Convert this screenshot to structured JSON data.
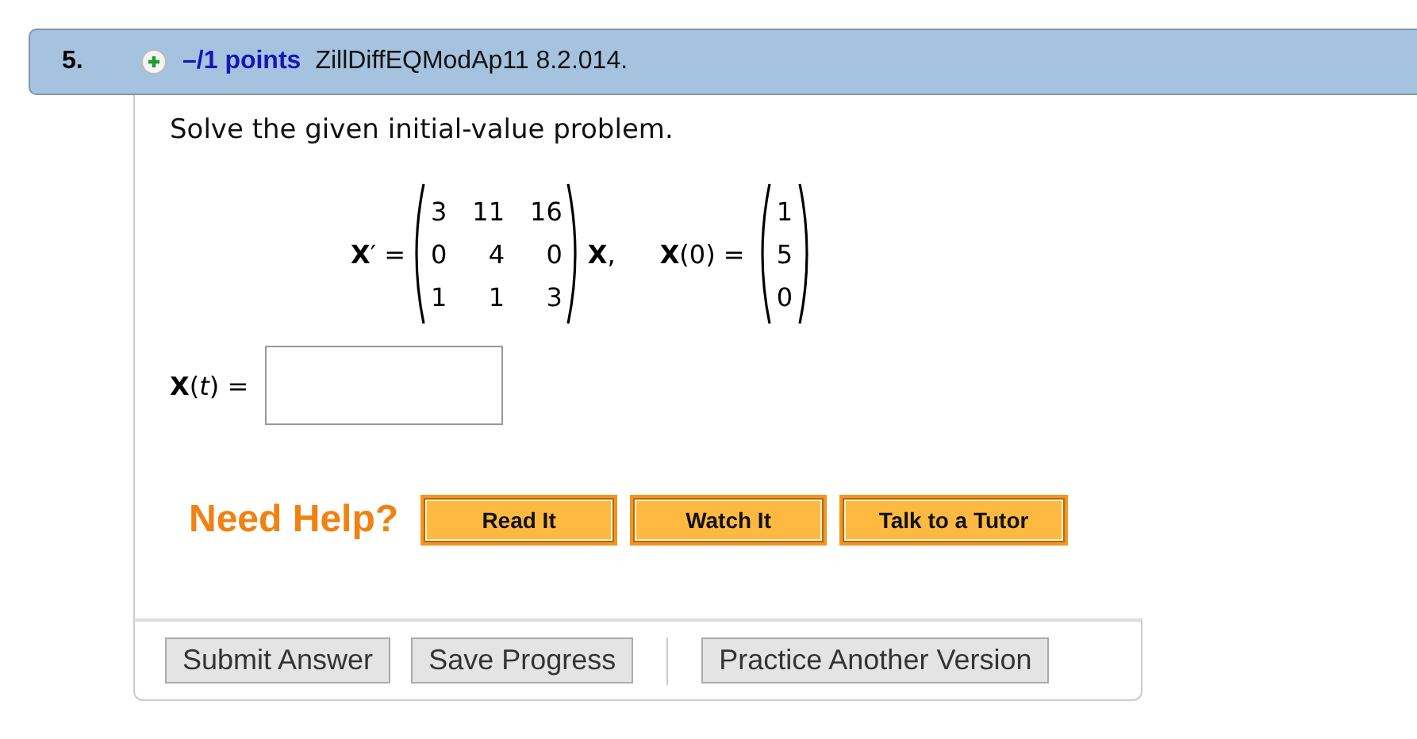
{
  "header": {
    "number": "5.",
    "points": "–/1 points",
    "source": "ZillDiffEQModAp11 8.2.014."
  },
  "prompt": "Solve the given initial-value problem.",
  "equation": {
    "lhs": "**X**′ =",
    "matrix": [
      [
        "3",
        "11",
        "16"
      ],
      [
        "0",
        "4",
        "0"
      ],
      [
        "1",
        "1",
        "3"
      ]
    ],
    "after_matrix": "**X**,",
    "initial_lhs": "**X**(0) =",
    "vector": [
      "1",
      "5",
      "0"
    ]
  },
  "answer": {
    "label": "**X**(*t*) ="
  },
  "help": {
    "label": "Need Help?",
    "buttons": [
      "Read It",
      "Watch It",
      "Talk to a Tutor"
    ]
  },
  "actions": [
    {
      "label": "Submit Answer",
      "kind": "button"
    },
    {
      "label": "Save Progress",
      "kind": "button"
    },
    {
      "kind": "separator"
    },
    {
      "label": "Practice Another Version",
      "kind": "button"
    }
  ]
}
